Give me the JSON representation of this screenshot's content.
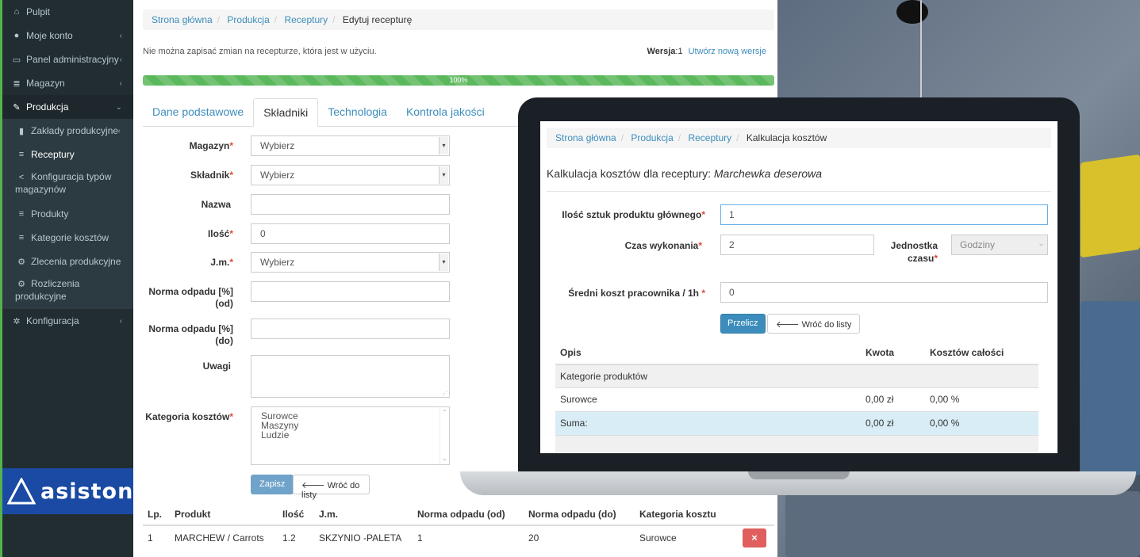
{
  "sidebar": {
    "items": [
      {
        "label": "Pulpit",
        "icon": "home-icon"
      },
      {
        "label": "Moje konto",
        "icon": "user-icon"
      },
      {
        "label": "Panel administracyjny",
        "icon": "monitor-icon"
      },
      {
        "label": "Magazyn",
        "icon": "database-icon"
      },
      {
        "label": "Produkcja",
        "icon": "wrench-icon"
      },
      {
        "label": "Zakłady produkcyjne",
        "icon": "building-icon"
      },
      {
        "label": "Receptury",
        "icon": "list-icon"
      },
      {
        "label": "Konfiguracja typów magazynów",
        "icon": "share-icon"
      },
      {
        "label": "Produkty",
        "icon": "list-icon"
      },
      {
        "label": "Kategorie kosztów",
        "icon": "list-icon"
      },
      {
        "label": "Zlecenia produkcyjne",
        "icon": "cogs-icon"
      },
      {
        "label": "Rozliczenia produkcyjne",
        "icon": "cogs-icon"
      },
      {
        "label": "Konfiguracja",
        "icon": "gear-icon"
      }
    ],
    "logo_text": "asiston"
  },
  "main": {
    "breadcrumb": [
      "Strona główna",
      "Produkcja",
      "Receptury",
      "Edytuj recepturę"
    ],
    "warning": "Nie można zapisać zmian na recepturze, która jest w użyciu.",
    "version_label": "Wersja",
    "version_value": ":1",
    "new_version_link": "Utwórz nową wersje",
    "progress_value": 100,
    "progress_text": "100%",
    "tabs": [
      "Dane podstawowe",
      "Składniki",
      "Technologia",
      "Kontrola jakości"
    ],
    "active_tab": "Składniki",
    "form": {
      "magazyn_label": "Magazyn",
      "magazyn_value": "Wybierz",
      "skladnik_label": "Składnik",
      "skladnik_value": "Wybierz",
      "nazwa_label": "Nazwa",
      "nazwa_value": "",
      "ilosc_label": "Ilość",
      "ilosc_value": "0",
      "jm_label": "J.m.",
      "jm_value": "Wybierz",
      "norma_od_label": "Norma odpadu [%] (od)",
      "norma_do_label": "Norma odpadu [%] (do)",
      "uwagi_label": "Uwagi",
      "kategoria_label": "Kategoria kosztów",
      "kategoria_options": [
        "Surowce",
        "Maszyny",
        "Ludzie"
      ],
      "save_label": "Zapisz",
      "back_label": "Wróć do listy"
    },
    "table": {
      "headers": [
        "Lp.",
        "Produkt",
        "Ilość",
        "J.m.",
        "Norma odpadu (od)",
        "Norma odpadu (do)",
        "Kategoria kosztu"
      ],
      "rows": [
        {
          "lp": "1",
          "produkt": "MARCHEW / Carrots",
          "ilosc": "1.2",
          "jm": "SKZYNIO -PALETA",
          "od": "1",
          "do": "20",
          "kategoria": "Surowce"
        }
      ],
      "delete_label": "×"
    }
  },
  "laptop": {
    "breadcrumb": [
      "Strona główna",
      "Produkcja",
      "Receptury",
      "Kalkulacja kosztów"
    ],
    "title_prefix": "Kalkulacja kosztów dla receptury: ",
    "title_recipe": "Marchewka deserowa",
    "ilosc_label": "Ilość sztuk produktu głównego",
    "ilosc_value": "1",
    "czas_label": "Czas wykonania",
    "czas_value": "2",
    "jednostka_label": "Jednostka czasu",
    "jednostka_value": "Godziny",
    "koszt_label": "Średni koszt pracownika / 1h ",
    "koszt_value": "0",
    "przelicz_label": "Przelicz",
    "back_label": "Wróć do listy",
    "table": {
      "headers": [
        "Opis",
        "Kwota",
        "Kosztów całości"
      ],
      "group": "Kategorie produktów",
      "rows": [
        {
          "opis": "Surowce",
          "kwota": "0,00 zł",
          "proc": "0,00 %"
        },
        {
          "opis": "Suma:",
          "kwota": "0,00 zł",
          "proc": "0,00 %"
        }
      ]
    }
  },
  "colors": {
    "accent": "#3c8dbc",
    "sidebar": "#222d32",
    "success": "#5cb85c",
    "danger": "#e05e5e",
    "logo_bg": "#1a4aa3"
  }
}
